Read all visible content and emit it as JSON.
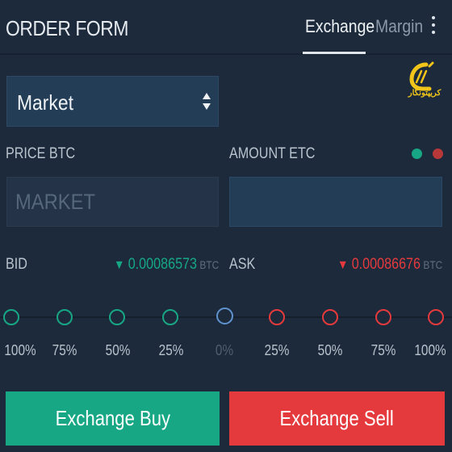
{
  "header": {
    "title": "ORDER FORM",
    "tabs": [
      {
        "label": "Exchange",
        "active": true
      },
      {
        "label": "Margin",
        "active": false
      }
    ]
  },
  "watermark": {
    "text": "کریپتونگار"
  },
  "order_type": {
    "selected": "Market"
  },
  "price_field": {
    "label": "PRICE BTC",
    "placeholder": "MARKET"
  },
  "amount_field": {
    "label": "AMOUNT ETC",
    "value": ""
  },
  "bid": {
    "label": "BID",
    "price": "0.00086573",
    "unit": "BTC",
    "color": "#17a784"
  },
  "ask": {
    "label": "ASK",
    "price": "0.00086676",
    "unit": "BTC",
    "color": "#e53a3d"
  },
  "slider": {
    "labels": [
      "100%",
      "75%",
      "50%",
      "25%",
      "0%",
      "25%",
      "50%",
      "75%",
      "100%"
    ],
    "selected": "0%"
  },
  "buttons": {
    "buy": "Exchange Buy",
    "sell": "Exchange Sell"
  },
  "colors": {
    "background": "#1c2a3b",
    "buy": "#17a784",
    "sell": "#e53a3d",
    "neutral": "#5f92cf"
  }
}
